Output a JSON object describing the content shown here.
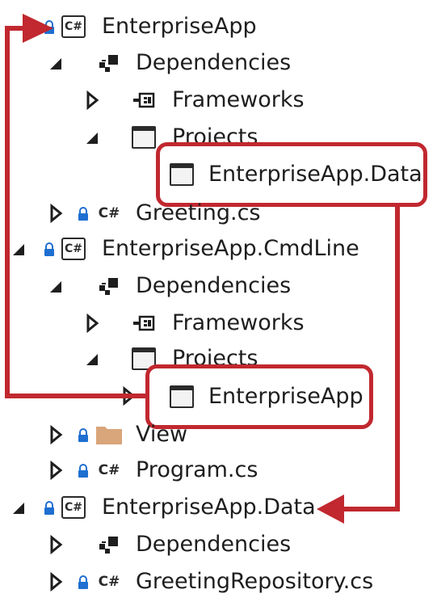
{
  "tree": {
    "rows": [
      {
        "label": "EnterpriseApp",
        "icon": "csproj-icon",
        "expand": "none-partial",
        "lock": true
      },
      {
        "label": "Dependencies",
        "icon": "dependencies-icon",
        "expand": "expanded"
      },
      {
        "label": "Frameworks",
        "icon": "frameworks-icon",
        "expand": "collapsed"
      },
      {
        "label": "Projects",
        "icon": "project-reference-icon",
        "expand": "expanded"
      },
      {
        "label": "EnterpriseApp.Data",
        "icon": "project-reference-icon",
        "highlighted": true
      },
      {
        "label": "Greeting.cs",
        "icon": "csharp-file-icon",
        "expand": "collapsed",
        "lock": true
      },
      {
        "label": "EnterpriseApp.CmdLine",
        "icon": "csproj-icon",
        "expand": "expanded",
        "lock": true
      },
      {
        "label": "Dependencies",
        "icon": "dependencies-icon",
        "expand": "expanded"
      },
      {
        "label": "Frameworks",
        "icon": "frameworks-icon",
        "expand": "collapsed"
      },
      {
        "label": "Projects",
        "icon": "project-reference-icon",
        "expand": "expanded"
      },
      {
        "label": "EnterpriseApp",
        "icon": "project-reference-icon",
        "expand": "collapsed",
        "highlighted": true
      },
      {
        "label": "View",
        "icon": "folder-icon",
        "expand": "collapsed",
        "lock": true
      },
      {
        "label": "Program.cs",
        "icon": "csharp-file-icon",
        "expand": "collapsed",
        "lock": true
      },
      {
        "label": "EnterpriseApp.Data",
        "icon": "csproj-icon",
        "expand": "expanded",
        "lock": true
      },
      {
        "label": "Dependencies",
        "icon": "dependencies-icon",
        "expand": "collapsed"
      },
      {
        "label": "GreetingRepository.cs",
        "icon": "csharp-file-icon",
        "expand": "collapsed",
        "lock": true
      }
    ]
  },
  "colors": {
    "annotation": "#c1282f",
    "text": "#1e1e1e",
    "lock": "#1e6fd1",
    "folder": "#dcb67a"
  }
}
